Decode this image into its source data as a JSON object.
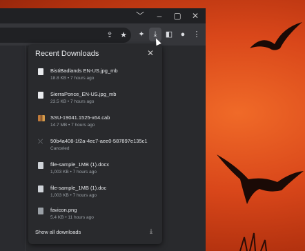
{
  "window": {
    "title_controls": [
      "﹀",
      "–",
      "▢",
      "✕"
    ]
  },
  "toolbar": {
    "icons": [
      "share-icon",
      "star-icon",
      "extensions-icon",
      "download-icon",
      "sidepanel-icon",
      "profile-icon",
      "menu-icon"
    ]
  },
  "downloads": {
    "title": "Recent Downloads",
    "close_label": "✕",
    "items": [
      {
        "name": "BistiBadlands EN-US.jpg_mb",
        "meta": "18.8 KB • 7 hours ago",
        "icon": "file-icon"
      },
      {
        "name": "SierraPonce_EN-US.jpg_mb",
        "meta": "23.5 KB • 7 hours ago",
        "icon": "file-icon"
      },
      {
        "name": "SSU-19041.1525-x64.cab",
        "meta": "14.7 MB • 7 hours ago",
        "icon": "cab-archive-icon"
      },
      {
        "name": "50b4a408-1f2a-4ec7-aee0-587897e135c1",
        "meta": "Canceled",
        "icon": "canceled-icon"
      },
      {
        "name": "file-sample_1MB (1).docx",
        "meta": "1,003 KB • 7 hours ago",
        "icon": "document-icon"
      },
      {
        "name": "file-sample_1MB (1).doc",
        "meta": "1,003 KB • 7 hours ago",
        "icon": "document-icon"
      },
      {
        "name": "favicon.png",
        "meta": "5.4 KB • 11 hours ago",
        "icon": "image-file-icon"
      }
    ],
    "show_all_label": "Show all downloads"
  }
}
